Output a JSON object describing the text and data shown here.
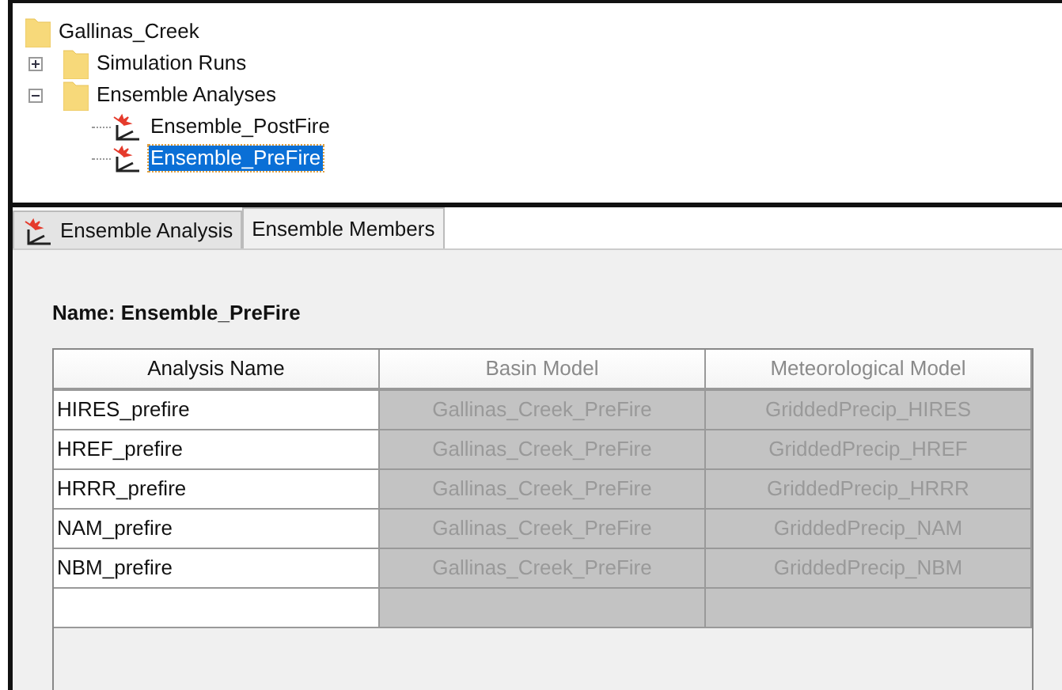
{
  "tree": [
    {
      "label": "Gallinas_Creek",
      "kind": "folder",
      "selected": false,
      "children": [
        {
          "label": "Simulation Runs",
          "kind": "folder",
          "selected": false,
          "expanded": false
        },
        {
          "label": "Ensemble Analyses",
          "kind": "folder",
          "selected": false,
          "expanded": true,
          "children": [
            {
              "label": "Ensemble_PostFire",
              "kind": "analysis",
              "selected": false
            },
            {
              "label": "Ensemble_PreFire",
              "kind": "analysis",
              "selected": true
            }
          ]
        }
      ]
    }
  ],
  "tabs": [
    {
      "label": "Ensemble Analysis",
      "icon": true,
      "selected": false
    },
    {
      "label": "Ensemble Members",
      "icon": false,
      "selected": true
    }
  ],
  "name_label": "Name: Ensemble_PreFire",
  "table": {
    "columns": [
      {
        "label": "Analysis Name",
        "disabled": false
      },
      {
        "label": "Basin Model",
        "disabled": true
      },
      {
        "label": "Meteorological Model",
        "disabled": true
      }
    ],
    "rows": [
      [
        "HIRES_prefire",
        "Gallinas_Creek_PreFire",
        "GriddedPrecip_HIRES"
      ],
      [
        "HREF_prefire",
        "Gallinas_Creek_PreFire",
        "GriddedPrecip_HREF"
      ],
      [
        "HRRR_prefire",
        "Gallinas_Creek_PreFire",
        "GriddedPrecip_HRRR"
      ],
      [
        "NAM_prefire",
        "Gallinas_Creek_PreFire",
        "GriddedPrecip_NAM"
      ],
      [
        "NBM_prefire",
        "Gallinas_Creek_PreFire",
        "GriddedPrecip_NBM"
      ]
    ]
  }
}
